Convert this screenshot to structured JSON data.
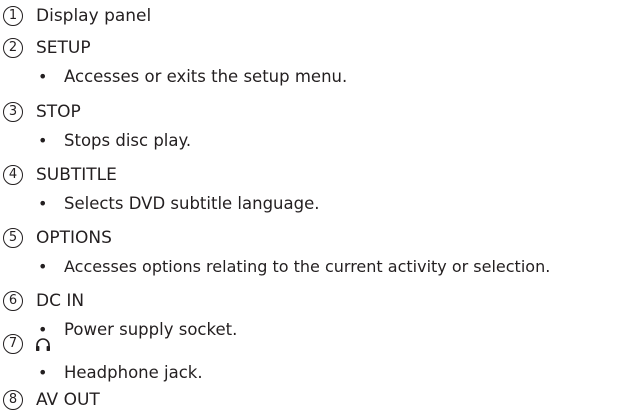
{
  "items": [
    {
      "number": "1",
      "title": "Display panel"
    },
    {
      "number": "2",
      "title": "SETUP",
      "description": "Accesses or exits the setup menu."
    },
    {
      "number": "3",
      "title": "STOP",
      "description": "Stops disc play."
    },
    {
      "number": "4",
      "title": "SUBTITLE",
      "description": "Selects DVD subtitle language."
    },
    {
      "number": "5",
      "title": "OPTIONS",
      "description": "Accesses options relating to the current activity or selection."
    },
    {
      "number": "6",
      "title": "DC IN",
      "description": "Power supply socket."
    },
    {
      "number": "7",
      "icon": "headphone-icon",
      "description": "Headphone jack."
    },
    {
      "number": "8",
      "title": "AV OUT"
    }
  ],
  "bullet_char": "•"
}
